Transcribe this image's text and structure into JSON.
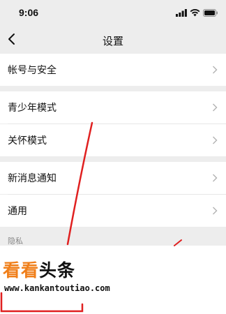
{
  "status_bar": {
    "time": "9:06"
  },
  "nav": {
    "title": "设置"
  },
  "groups": [
    {
      "items": [
        "帐号与安全"
      ]
    },
    {
      "items": [
        "青少年模式",
        "关怀模式"
      ]
    },
    {
      "items": [
        "新消息通知",
        "通用"
      ]
    }
  ],
  "section": {
    "privacy_label": "隐私"
  },
  "watermark": {
    "brand_part1": "看看",
    "brand_part2": "头条",
    "url": "www.kankantoutiao.com"
  },
  "colors": {
    "background": "#ededed",
    "row": "#ffffff",
    "annotation_red": "#e02020",
    "brand_orange": "#f07f1a"
  },
  "icons": [
    "cellular-signal-icon",
    "wifi-icon",
    "battery-icon",
    "back-chevron-icon",
    "chevron-right-icon"
  ]
}
